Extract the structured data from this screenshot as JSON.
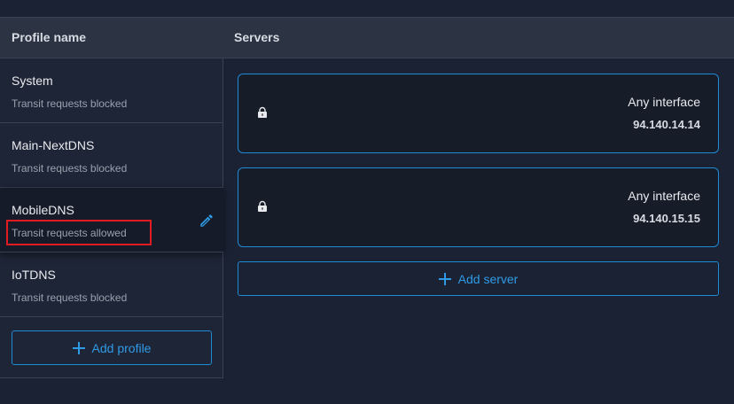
{
  "table": {
    "col_profile": "Profile name",
    "col_servers": "Servers"
  },
  "profiles": [
    {
      "name": "System",
      "status": "Transit requests blocked"
    },
    {
      "name": "Main-NextDNS",
      "status": "Transit requests blocked"
    },
    {
      "name": "MobileDNS",
      "status": "Transit requests allowed"
    },
    {
      "name": "IoTDNS",
      "status": "Transit requests blocked"
    }
  ],
  "add_profile_label": "Add profile",
  "servers": [
    {
      "interface": "Any interface",
      "ip": "94.140.14.14"
    },
    {
      "interface": "Any interface",
      "ip": "94.140.15.15"
    }
  ],
  "add_server_label": "Add server",
  "colors": {
    "accent": "#1f8ad6",
    "highlight": "#e11b22",
    "background": "#1b2233"
  }
}
